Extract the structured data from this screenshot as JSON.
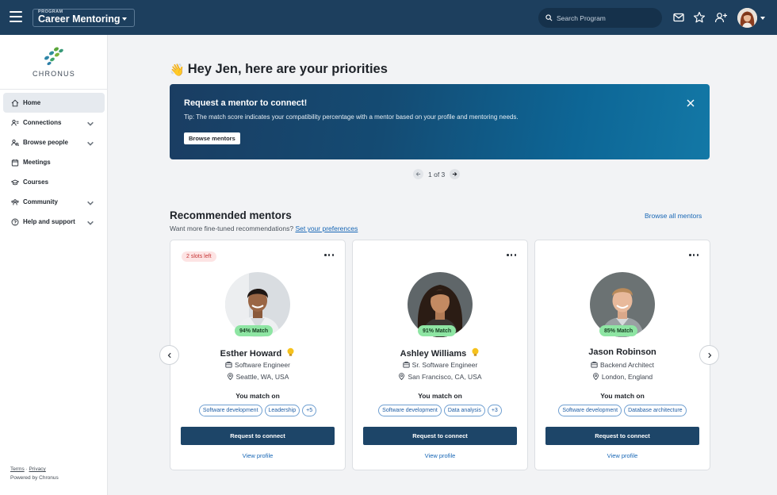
{
  "topbar": {
    "program_kicker": "PROGRAM",
    "program_name": "Career Mentoring",
    "search_placeholder": "Search Program",
    "icons": [
      "menu-icon",
      "mail-icon",
      "star-icon",
      "add-user-icon",
      "avatar"
    ],
    "bg_color": "#1d3f5e"
  },
  "sidebar": {
    "logo_text": "CHRONUS",
    "items": [
      {
        "label": "Home",
        "icon": "home-icon",
        "active": true,
        "expandable": false
      },
      {
        "label": "Connections",
        "icon": "connections-icon",
        "active": false,
        "expandable": true
      },
      {
        "label": "Browse people",
        "icon": "people-icon",
        "active": false,
        "expandable": true
      },
      {
        "label": "Meetings",
        "icon": "calendar-icon",
        "active": false,
        "expandable": false
      },
      {
        "label": "Courses",
        "icon": "graduation-cap-icon",
        "active": false,
        "expandable": false
      },
      {
        "label": "Community",
        "icon": "community-icon",
        "active": false,
        "expandable": true
      },
      {
        "label": "Help and support",
        "icon": "help-icon",
        "active": false,
        "expandable": true
      }
    ],
    "footer": {
      "terms": "Terms",
      "separator": "·",
      "privacy": "Privacy",
      "powered_by": "Powered by Chronus"
    }
  },
  "main": {
    "greeting_emoji": "👋",
    "greeting": "Hey Jen, here are your priorities",
    "banner": {
      "title": "Request a mentor to connect!",
      "tip": "Tip: The match score indicates your compatibility percentage with a mentor based on your profile and mentoring needs.",
      "button": "Browse mentors"
    },
    "pager": {
      "text": "1 of 3"
    },
    "recommended": {
      "title": "Recommended mentors",
      "subtitle": "Want more fine-tuned recommendations?",
      "subtitle_link": "Set your preferences",
      "browse_all": "Browse all mentors",
      "you_match_on": "You match on",
      "connect_label": "Request to connect",
      "view_profile": "View profile",
      "mentors": [
        {
          "slots": "2 slots left",
          "match": "94% Match",
          "name": "Esther Howard",
          "title": "Software Engineer",
          "location": "Seattle, WA, USA",
          "chips": [
            "Software development",
            "Leadership",
            "+5"
          ],
          "badge": true
        },
        {
          "slots": "",
          "match": "91% Match",
          "name": "Ashley Williams",
          "title": "Sr. Software Engineer",
          "location": "San Francisco, CA, USA",
          "chips": [
            "Software development",
            "Data analysis",
            "+3"
          ],
          "badge": true
        },
        {
          "slots": "",
          "match": "85% Match",
          "name": "Jason Robinson",
          "title": "Backend Architect",
          "location": "London, England",
          "chips": [
            "Software development",
            "Database architecture"
          ],
          "badge": false
        }
      ]
    }
  }
}
